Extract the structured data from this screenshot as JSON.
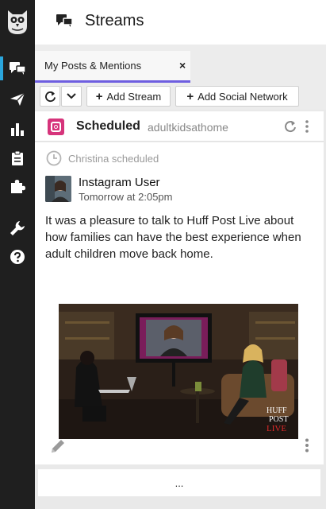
{
  "app": {
    "logo_icon": "owl-logo-icon"
  },
  "nav_rail": {
    "items": [
      {
        "name": "streams",
        "icon": "streams-icon",
        "active": true
      },
      {
        "name": "publisher",
        "icon": "paper-plane-icon",
        "active": false
      },
      {
        "name": "analytics",
        "icon": "bar-chart-icon",
        "active": false
      },
      {
        "name": "assignments",
        "icon": "clipboard-icon",
        "active": false
      },
      {
        "name": "apps",
        "icon": "puzzle-icon",
        "active": false
      },
      {
        "name": "tools",
        "icon": "wrench-icon",
        "active": false
      },
      {
        "name": "help",
        "icon": "help-icon",
        "active": false
      }
    ],
    "accent": "#2aa6dd"
  },
  "header": {
    "title": "Streams"
  },
  "tabs": [
    {
      "label": "My Posts & Mentions",
      "close": "×",
      "active": true
    }
  ],
  "toolbar": {
    "add_stream_label": "Add Stream",
    "add_network_label": "Add Social Network"
  },
  "stream": {
    "title": "Scheduled",
    "account": "adultkidsathome",
    "network_icon": "instagram-icon",
    "network_color": "#d6347b"
  },
  "post": {
    "scheduled_by": "Christina scheduled",
    "author": "Instagram User",
    "time": "Tomorrow at 2:05pm",
    "text": "It was a pleasure to talk to Huff Post Live about how families can have the best experience when adult children move back home.",
    "media_watermark": [
      "HUFF",
      "POST",
      "LIVE"
    ]
  },
  "footer": {
    "more_label": "..."
  },
  "colors": {
    "tab_underline": "#6e5ee0",
    "rail_bg": "#1f1f1f"
  }
}
